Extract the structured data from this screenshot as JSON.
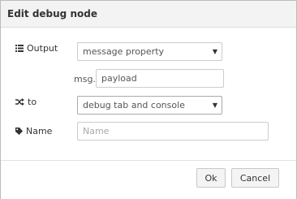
{
  "window": {
    "title": "Edit debug node"
  },
  "form": {
    "output": {
      "label": "Output",
      "value": "message property"
    },
    "msg": {
      "prefix": "msg.",
      "value": "payload"
    },
    "to": {
      "label": "to",
      "value": "debug tab and console"
    },
    "name": {
      "label": "Name",
      "placeholder": "Name",
      "value": ""
    }
  },
  "buttons": {
    "ok": "Ok",
    "cancel": "Cancel"
  },
  "icons": {
    "output": "list-icon",
    "to": "shuffle-icon",
    "name": "tag-icon",
    "caret": "caret-down-icon"
  }
}
